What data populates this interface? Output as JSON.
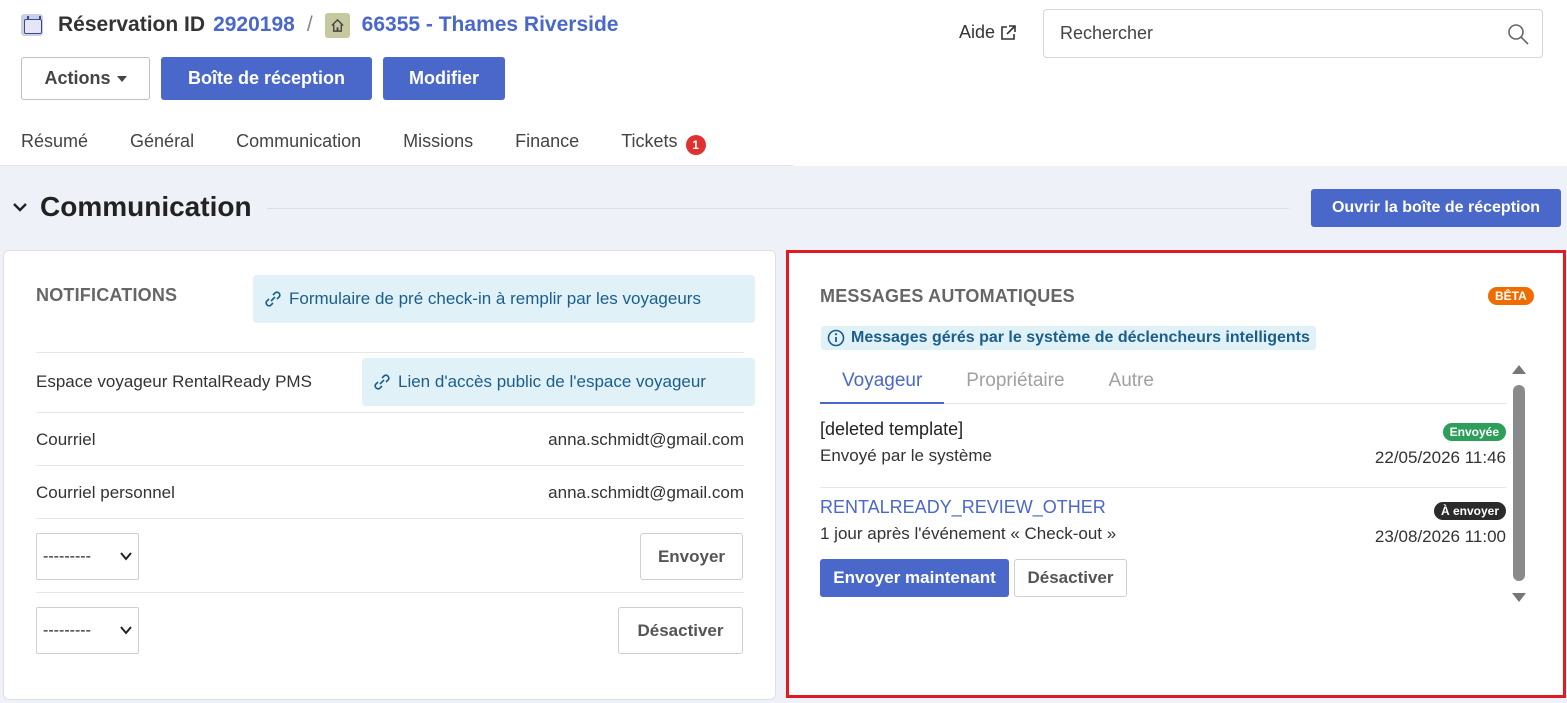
{
  "header": {
    "title_prefix": "Réservation ID",
    "reservation_id": "2920198",
    "separator": "/",
    "property": "66355 - Thames Riverside",
    "help_label": "Aide",
    "search_placeholder": "Rechercher"
  },
  "toolbar": {
    "actions_label": "Actions",
    "inbox_label": "Boîte de réception",
    "edit_label": "Modifier"
  },
  "tabs": [
    {
      "label": "Résumé"
    },
    {
      "label": "Général"
    },
    {
      "label": "Communication"
    },
    {
      "label": "Missions"
    },
    {
      "label": "Finance"
    },
    {
      "label": "Tickets",
      "badge": "1"
    }
  ],
  "section": {
    "title": "Communication",
    "open_inbox_label": "Ouvrir la boîte de réception"
  },
  "notifications": {
    "heading": "NOTIFICATIONS",
    "precheckin_link": "Formulaire de pré check-in à remplir par les voyageurs",
    "guest_space_label": "Espace voyageur RentalReady PMS",
    "guest_space_link": "Lien d'accès public de l'espace voyageur",
    "email_label": "Courriel",
    "email_value": "anna.schmidt@gmail.com",
    "personal_email_label": "Courriel personnel",
    "personal_email_value": "anna.schmidt@gmail.com",
    "select1_value": "---------",
    "send_label": "Envoyer",
    "select2_value": "---------",
    "disable_label": "Désactiver"
  },
  "auto_messages": {
    "heading": "MESSAGES AUTOMATIQUES",
    "beta_label": "BÊTA",
    "info_text": "Messages gérés par le système de déclencheurs intelligents",
    "tabs": [
      {
        "label": "Voyageur",
        "active": true
      },
      {
        "label": "Propriétaire",
        "active": false
      },
      {
        "label": "Autre",
        "active": false
      }
    ],
    "messages": [
      {
        "title": "[deleted template]",
        "subtitle": "Envoyé par le système",
        "status": "Envoyée",
        "status_color": "#2e9e5b",
        "date": "22/05/2026 11:46"
      },
      {
        "title": "RENTALREADY_REVIEW_OTHER",
        "subtitle": "1 jour après l'événement « Check-out »",
        "status": "À envoyer",
        "status_color": "#2b2b2b",
        "date": "23/08/2026 11:00",
        "send_now_label": "Envoyer maintenant",
        "disable_label": "Désactiver"
      }
    ]
  },
  "colors": {
    "primary": "#4a68c9",
    "highlight_border": "#e01b22",
    "badge_red": "#e03131",
    "beta_orange": "#ef6c00"
  }
}
